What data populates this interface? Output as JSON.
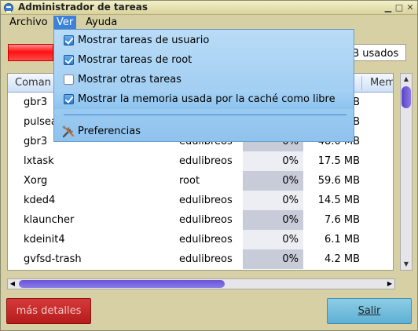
{
  "window": {
    "title": "Administrador de tareas"
  },
  "menubar": {
    "archivo": "Archivo",
    "ver": "Ver",
    "ayuda": "Ayuda"
  },
  "memory": {
    "label": "MB usados"
  },
  "columns": {
    "command": "Coman",
    "memory": "Memo"
  },
  "processes": [
    {
      "command": "gbr3",
      "user": "",
      "cpu": "",
      "mem": "B"
    },
    {
      "command": "pulsea",
      "user": "",
      "cpu": "",
      "mem": "B"
    },
    {
      "command": "gbr3",
      "user": "edulibreos",
      "cpu": "0%",
      "mem": "48.0 MB"
    },
    {
      "command": "lxtask",
      "user": "edulibreos",
      "cpu": "0%",
      "mem": "17.5 MB"
    },
    {
      "command": "Xorg",
      "user": "root",
      "cpu": "0%",
      "mem": "59.6 MB"
    },
    {
      "command": "kded4",
      "user": "edulibreos",
      "cpu": "0%",
      "mem": "14.5 MB"
    },
    {
      "command": "klauncher",
      "user": "edulibreos",
      "cpu": "0%",
      "mem": "7.6 MB"
    },
    {
      "command": "kdeinit4",
      "user": "edulibreos",
      "cpu": "0%",
      "mem": "6.1 MB"
    },
    {
      "command": "gvfsd-trash",
      "user": "edulibreos",
      "cpu": "0%",
      "mem": "4.2 MB"
    }
  ],
  "menu_ver": {
    "items": [
      {
        "label": "Mostrar tareas de usuario",
        "checked": true
      },
      {
        "label": "Mostrar tareas de root",
        "checked": true
      },
      {
        "label": "Mostrar otras tareas",
        "checked": false
      },
      {
        "label": "Mostrar la memoria usada por la caché como libre",
        "checked": true
      }
    ],
    "preferences": "Preferencias"
  },
  "buttons": {
    "details": "más detalles",
    "quit": "Salir"
  }
}
